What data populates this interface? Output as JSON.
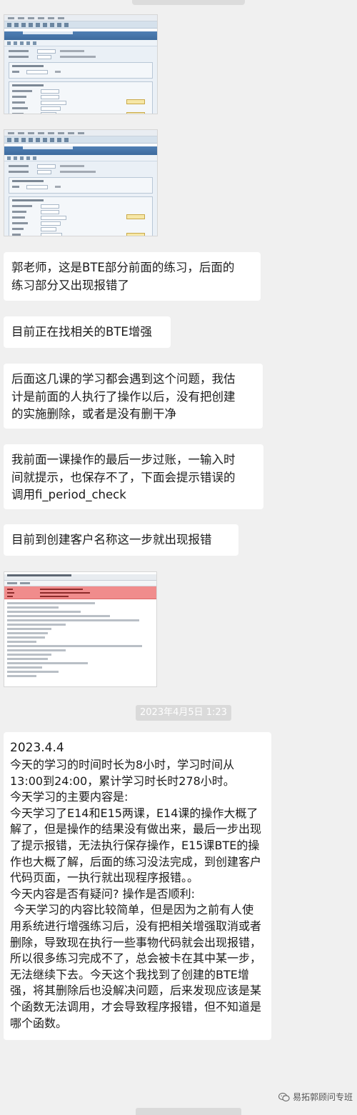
{
  "messages": [
    "郭老师，这是BTE部分前面的练习，后面的\n练习部分又出现报错了",
    "目前正在找相关的BTE增强",
    "后面这几课的学习都会遇到这个问题，我估\n计是前面的人执行了操作以后，没有把创建\n的实施删除，或者是没有删干净",
    "我前面一课操作的最后一步过账，一输入时\n间就提示，也保存不了，下面会提示错误的\n调用fi_period_check",
    "目前到创建客户名称这一步就出现报错"
  ],
  "timestamp": "2023年4月5日 1:23",
  "diary": {
    "date": "2023.4.4",
    "lines": [
      "今天的学习的时间时长为8小时，学习时间从13:00到24:00，累计学习时长时278小时。",
      "今天学习的主要内容是:",
      "今天学习了E14和E15两课，E14课的操作大概了解了，但是操作的结果没有做出来，最后一步出现了提示报错，无法执行保存操作，E15课BTE的操作也大概了解，后面的练习没法完成，到创建客户代码页面，一执行就出现程序报错。。",
      "今天内容是否有疑问? 操作是否顺利:",
      " 今天学习的内容比较简单，但是因为之前有人使用系统进行增强练习后，没有把相关增强取消或者删除，导致现在执行一些事物代码就会出现报错，所以很多练习完成不了，总会被卡在其中某一步，无法继续下去。今天这个我找到了创建的BTE增强，将其删除后也没解决问题，后来发现应该是某个函数无法调用，才会导致程序报错，但不知道是哪个函数。"
    ]
  },
  "watermark": "易拓郭顾问专班",
  "colors": {
    "background": "#f0f0f0",
    "bubble": "#ffffff",
    "timestamp_pill": "#dadada",
    "sap_title": "#3e6b9e",
    "error_red": "#f08c8c"
  },
  "icons": [
    "wechat-channel-icon"
  ]
}
